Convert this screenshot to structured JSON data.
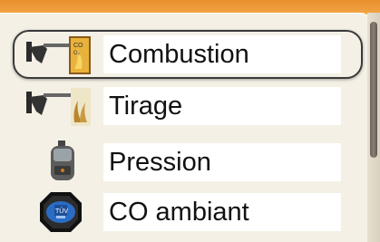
{
  "colors": {
    "accent_bar": "#ee9a3a",
    "panel_bg": "#f4f0e6",
    "label_bg": "#ffffff",
    "text": "#111111",
    "selection_frame": "#3a3a3a"
  },
  "menu": {
    "selected_index": 0,
    "items": [
      {
        "label": "Combustion",
        "icon": "combustion-probe-icon"
      },
      {
        "label": "Tirage",
        "icon": "draft-probe-icon"
      },
      {
        "label": "Pression",
        "icon": "pressure-instrument-icon"
      },
      {
        "label": "CO ambiant",
        "icon": "tuv-co-meter-icon"
      }
    ]
  }
}
